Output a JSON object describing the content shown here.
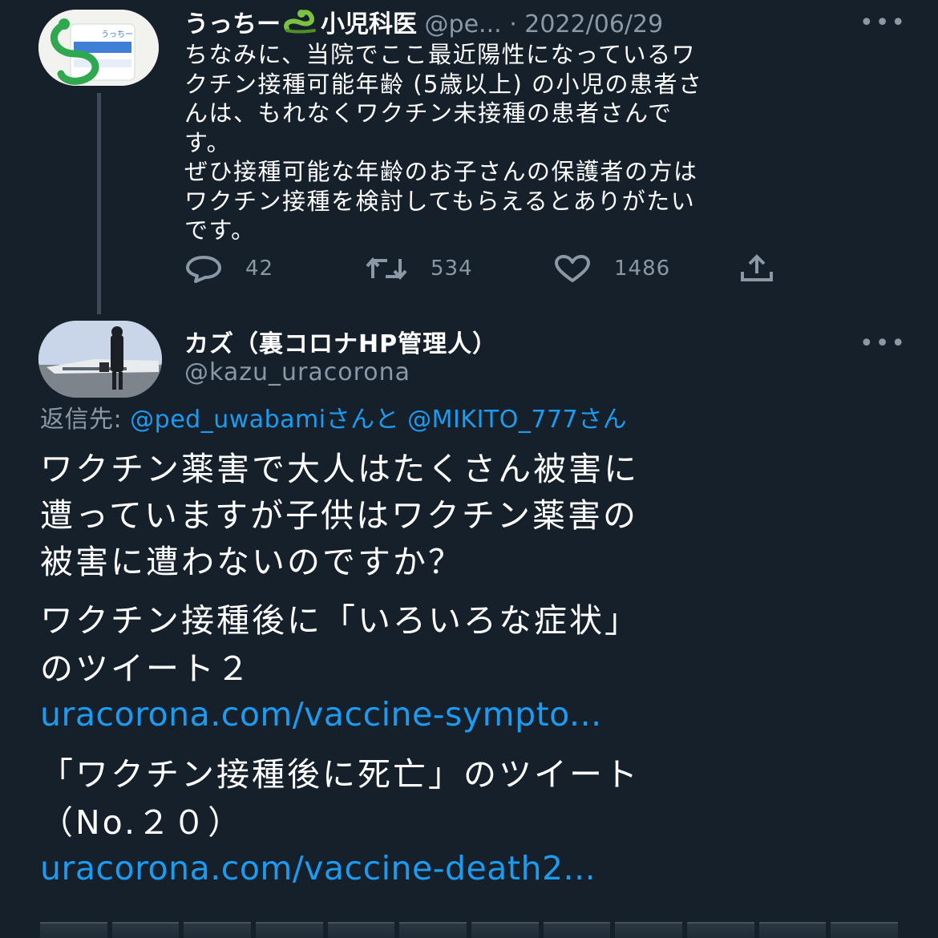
{
  "parent_tweet": {
    "display_name": "うっちー",
    "display_name_suffix": "小児科医",
    "name_emoji": "snake-icon",
    "handle": "@pe...",
    "separator": "·",
    "date": "2022/06/29",
    "more": "•••",
    "body_lines": [
      "ちなみに、当院でここ最近陽性になっているワ",
      "クチン接種可能年齢 (5歳以上) の小児の患者さ",
      "んは、もれなくワクチン未接種の患者さんで",
      "す。",
      "ぜひ接種可能な年齢のお子さんの保護者の方は",
      "ワクチン接種を検討してもらえるとありがたい",
      "です。"
    ],
    "actions": {
      "reply_count": "42",
      "retweet_count": "534",
      "like_count": "1486"
    }
  },
  "reply_tweet": {
    "display_name": "カズ（裏コロナHP管理人）",
    "handle": "@kazu_uracorona",
    "more": "•••",
    "reply_to": {
      "prefix": "返信先:",
      "mention_1": "@ped_uwabami",
      "joiner": "さんと",
      "mention_2": "@MIKITO_777",
      "suffix": "さん"
    },
    "body_1": [
      "ワクチン薬害で大人はたくさん被害に",
      "遭っていますが子供はワクチン薬害の",
      "被害に遭わないのですか？"
    ],
    "body_2": [
      "ワクチン接種後に「いろいろな症状」",
      "のツイート２"
    ],
    "link_1": "uracorona.com/vaccine-sympto...",
    "body_3": [
      "「ワクチン接種後に死亡」のツイート",
      "（No.２０）"
    ],
    "link_2": "uracorona.com/vaccine-death2..."
  },
  "colors": {
    "background": "#15202b",
    "text_primary": "#ffffff",
    "text_secondary": "#8b98a5",
    "link": "#1d9bf0",
    "thread_line": "#3d4a57"
  }
}
